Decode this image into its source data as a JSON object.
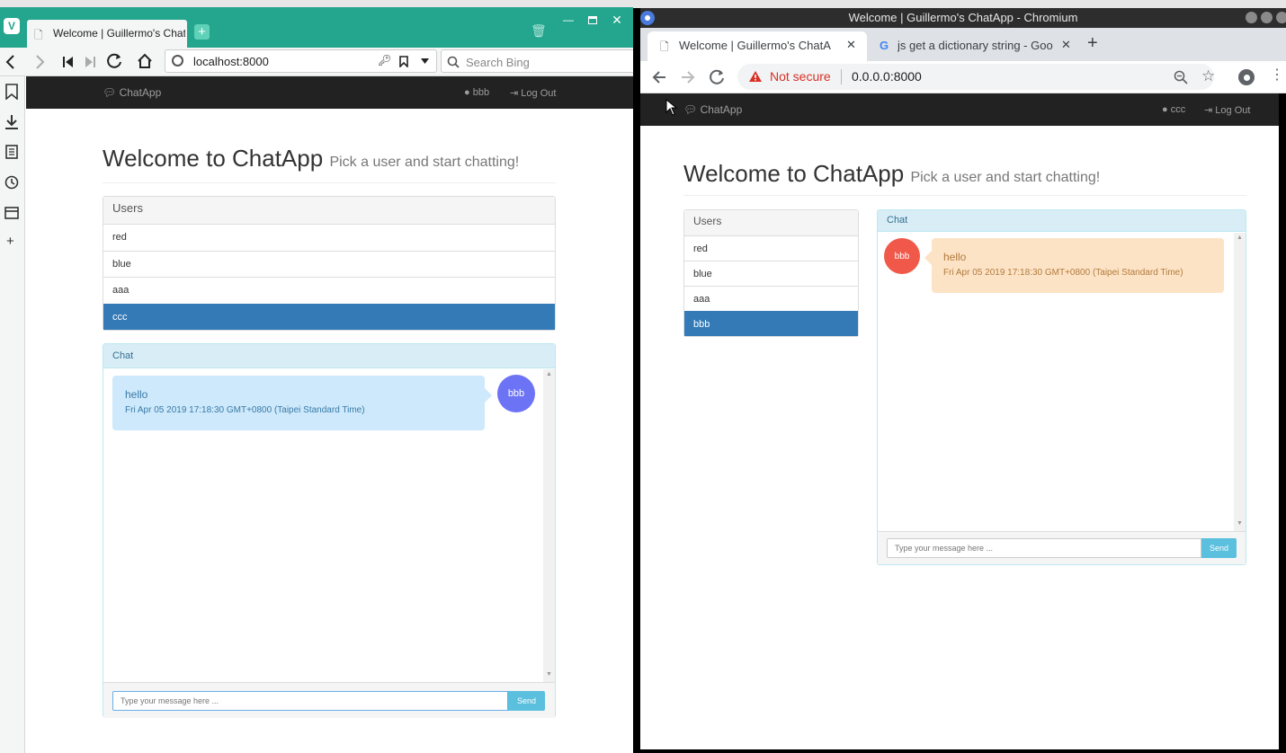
{
  "left_window": {
    "tab_title": "Welcome | Guillermo's Chat",
    "url": "localhost:8000",
    "search_placeholder": "Search Bing",
    "app": {
      "brand": "ChatApp",
      "user": "bbb",
      "logout": "Log Out",
      "heading": "Welcome to ChatApp",
      "subheading": "Pick a user and start chatting!",
      "users_title": "Users",
      "users": [
        "red",
        "blue",
        "aaa",
        "ccc"
      ],
      "active_user_index": 3,
      "chat_title": "Chat",
      "message": {
        "text": "hello",
        "time": "Fri Apr 05 2019 17:18:30 GMT+0800 (Taipei Standard Time)",
        "sender": "bbb"
      },
      "input_placeholder": "Type your message here ...",
      "send_label": "Send"
    }
  },
  "right_window": {
    "window_title": "Welcome | Guillermo's ChatApp - Chromium",
    "tabs": [
      {
        "label": "Welcome | Guillermo's ChatA"
      },
      {
        "label": "js get a dictionary string - Goo"
      }
    ],
    "security_label": "Not secure",
    "url": "0.0.0.0:8000",
    "app": {
      "brand": "ChatApp",
      "user": "ccc",
      "logout": "Log Out",
      "heading": "Welcome to ChatApp",
      "subheading": "Pick a user and start chatting!",
      "users_title": "Users",
      "users": [
        "red",
        "blue",
        "aaa",
        "bbb"
      ],
      "active_user_index": 3,
      "chat_title": "Chat",
      "message": {
        "text": "hello",
        "time": "Fri Apr 05 2019 17:18:30 GMT+0800 (Taipei Standard Time)",
        "sender": "bbb"
      },
      "input_placeholder": "Type your message here ...",
      "send_label": "Send"
    }
  },
  "colors": {
    "vivaldi_tabbar": "#24a58d",
    "navbar": "#222222",
    "active_item": "#337ab7",
    "chat_head": "#d9edf7",
    "bubble_left": "#cde9fb",
    "avatar_left": "#6c74f5",
    "bubble_right": "#fde3c5",
    "avatar_right": "#f0584a",
    "send_button": "#5bc0de",
    "warning": "#d93025"
  }
}
